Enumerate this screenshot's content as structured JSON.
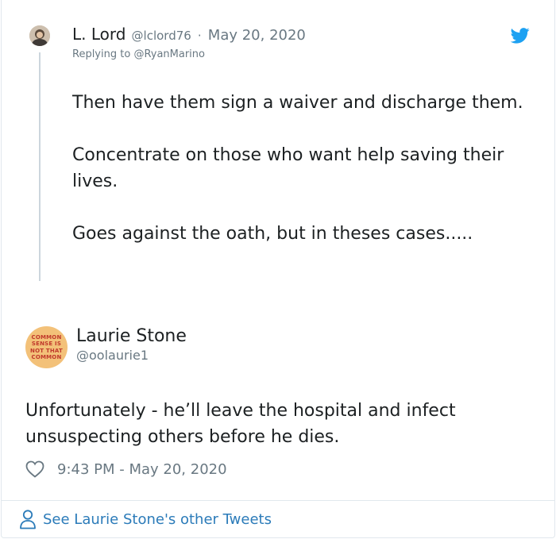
{
  "reply": {
    "author_name": "L. Lord",
    "author_handle": "@lclord76",
    "separator": "·",
    "date": "May 20, 2020",
    "replying_prefix": "Replying to",
    "replying_handle": "@RyanMarino",
    "paragraphs": [
      "Then have them sign a waiver and discharge them.",
      "Concentrate on those who want help saving their lives.",
      "Goes against the oath, but in theses cases....."
    ]
  },
  "main_tweet": {
    "author_name": "Laurie Stone",
    "author_handle": "@oolaurie1",
    "avatar_text": [
      "COMMON",
      "SENSE IS",
      "NOT THAT",
      "COMMON"
    ],
    "text": "Unfortunately - he’ll leave the hospital and infect unsuspecting others before he dies.",
    "timestamp": "9:43 PM - May 20, 2020"
  },
  "footer": {
    "link_text": "See Laurie Stone's other Tweets"
  },
  "colors": {
    "twitter_blue": "#1da1f2",
    "link_blue": "#2b7bb9",
    "muted_gray": "#697882",
    "text": "#1c2022",
    "avatar_bg": "#f3c179",
    "avatar_text": "#c0392b"
  },
  "icons": {
    "brand": "twitter-bird-icon",
    "like": "heart-icon",
    "profile": "person-icon"
  }
}
